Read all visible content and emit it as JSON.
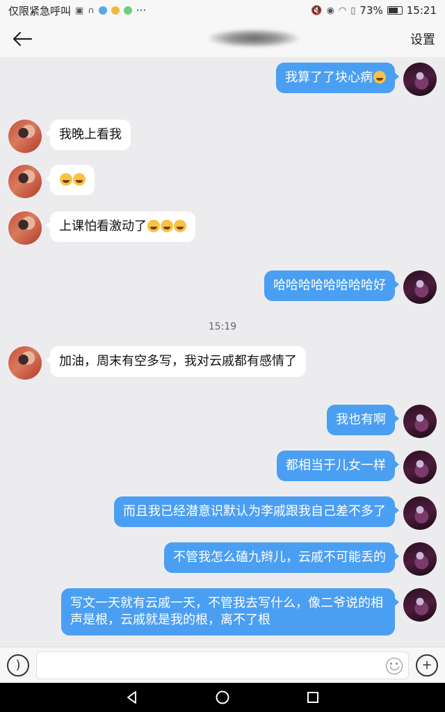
{
  "status_bar": {
    "carrier": "仅限紧急呼叫",
    "battery": "73%",
    "battery_level": 0.73,
    "time": "15:21",
    "more": "···"
  },
  "header": {
    "settings_label": "设置"
  },
  "messages": [
    {
      "side": "me",
      "text": "我算了了块心病",
      "emoji_count": 1
    },
    {
      "side": "other",
      "text": "我晚上看我",
      "emoji_count": 0
    },
    {
      "side": "other",
      "text": "",
      "emoji_count": 2
    },
    {
      "side": "other",
      "text": "上课怕看激动了",
      "emoji_count": 3
    },
    {
      "side": "me",
      "text": "哈哈哈哈哈哈哈哈好",
      "emoji_count": 0
    },
    {
      "side": "time",
      "text": "15:19"
    },
    {
      "side": "other",
      "text": "加油，周末有空多写，我对云戚都有感情了",
      "emoji_count": 0
    },
    {
      "side": "me",
      "text": "我也有啊",
      "emoji_count": 0
    },
    {
      "side": "me",
      "text": "都相当于儿女一样",
      "emoji_count": 0
    },
    {
      "side": "me",
      "text": "而且我已经潜意识默认为李戚跟我自己差不多了",
      "emoji_count": 0
    },
    {
      "side": "me",
      "text": "不管我怎么磕九辫儿，云戚不可能丢的",
      "emoji_count": 0
    },
    {
      "side": "me",
      "text": "写文一天就有云戚一天，不管我去写什么，像二爷说的相声是根，云戚就是我的根，离不了根",
      "emoji_count": 0
    }
  ],
  "input": {
    "value": "",
    "placeholder": ""
  },
  "colors": {
    "my_bubble": "#4b9ff2",
    "their_bubble": "#ffffff",
    "background": "#ececef"
  }
}
